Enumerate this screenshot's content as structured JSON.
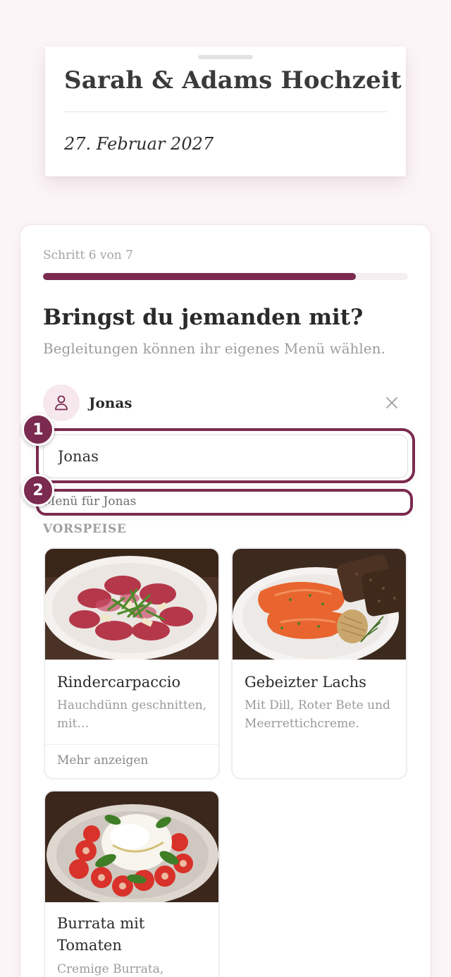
{
  "header": {
    "title": "Sarah & Adams Hochzeit",
    "date": "27. Februar 2027"
  },
  "progress": {
    "step_label": "Schritt 6 von 7",
    "current": 6,
    "total": 7
  },
  "question": {
    "title": "Bringst du jemanden mit?",
    "subtitle": "Begleitungen können ihr eigenes Menü wählen."
  },
  "guest": {
    "name": "Jonas",
    "input_value": "Jonas",
    "avatar_icon": "person-icon",
    "remove_icon": "close-icon"
  },
  "annotations": {
    "badge_1": "1",
    "badge_2": "2"
  },
  "menu": {
    "label": "Menü für Jonas",
    "section": "VORSPEISE",
    "dishes": [
      {
        "name": "Rindercarpaccio",
        "description": "Hauchdünn geschnitten, mit…",
        "more": "Mehr anzeigen"
      },
      {
        "name": "Gebeizter Lachs",
        "description": "Mit Dill, Roter Bete und Meerrettichcreme."
      },
      {
        "name": "Burrata mit Tomaten",
        "description": "Cremige Burrata,"
      }
    ]
  },
  "colors": {
    "accent": "#7b2a50",
    "background": "#fcf5f7",
    "avatar_bg": "#f6e8ed"
  }
}
